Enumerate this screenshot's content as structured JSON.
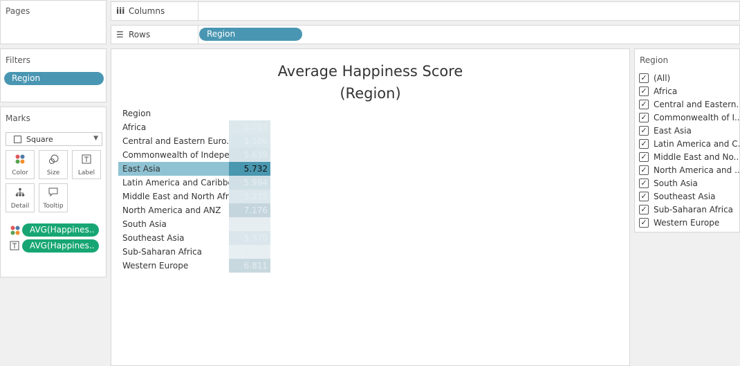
{
  "left": {
    "pages_title": "Pages",
    "filters_title": "Filters",
    "filter_pill": "Region",
    "marks_title": "Marks",
    "mark_type": "Square",
    "buttons": {
      "color": "Color",
      "size": "Size",
      "label": "Label",
      "detail": "Detail",
      "tooltip": "Tooltip"
    },
    "mark_pills": [
      "AVG(Happines..",
      "AVG(Happines.."
    ]
  },
  "shelves": {
    "columns_label": "Columns",
    "rows_label": "Rows",
    "rows_pill": "Region"
  },
  "canvas": {
    "title_line1": "Average Happiness Score",
    "title_line2": "(Region)",
    "header": "Region"
  },
  "chart_data": {
    "type": "table",
    "title": "Average Happiness Score",
    "subtitle": "(Region)",
    "row_header": "Region",
    "categories": [
      "Africa",
      "Central and Eastern Euro..",
      "Commonwealth of Indepe..",
      "East Asia",
      "Latin America and Caribbe..",
      "Middle East and North Afr..",
      "North America and ANZ",
      "South Asia",
      "Southeast Asia",
      "Sub-Saharan Africa",
      "Western Europe"
    ],
    "values": [
      "5.057",
      "5.586",
      "5.639",
      "5.732",
      "5.994",
      "5.275",
      "7.176",
      "4.473",
      "5.370",
      "4.289",
      "6.811"
    ],
    "colors": [
      "#dce8ec",
      "#d9e6eb",
      "#d6e4ea",
      "#4a97b0",
      "#d1e0e7",
      "#dbe7ec",
      "#c4d5dd",
      "#e6eef1",
      "#dae6eb",
      "#e8eff2",
      "#c8d8df"
    ],
    "selected": "East Asia"
  },
  "filter_card": {
    "title": "Region",
    "items": [
      "(All)",
      "Africa",
      "Central and Eastern...",
      "Commonwealth of I...",
      "East Asia",
      "Latin America and C...",
      "Middle East and No...",
      "North America and ...",
      "South Asia",
      "Southeast Asia",
      "Sub-Saharan Africa",
      "Western Europe"
    ]
  }
}
